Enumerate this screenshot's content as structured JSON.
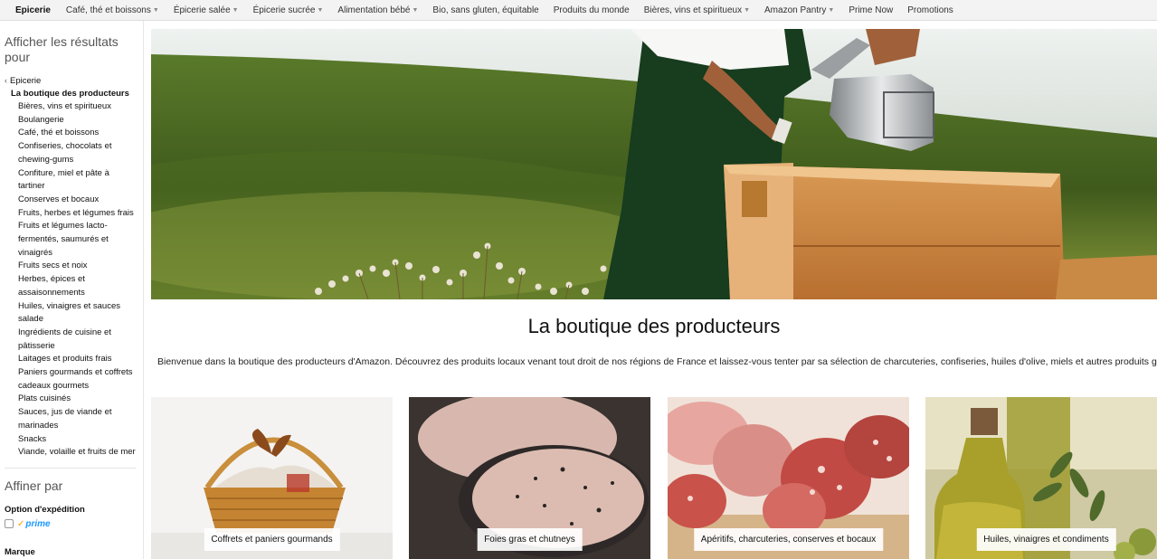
{
  "nav": {
    "brand": "Epicerie",
    "items": [
      {
        "label": "Café, thé et boissons",
        "dropdown": true
      },
      {
        "label": "Épicerie salée",
        "dropdown": true
      },
      {
        "label": "Épicerie sucrée",
        "dropdown": true
      },
      {
        "label": "Alimentation bébé",
        "dropdown": true
      },
      {
        "label": "Bio, sans gluten, équitable",
        "dropdown": false
      },
      {
        "label": "Produits du monde",
        "dropdown": false
      },
      {
        "label": "Bières, vins et spiritueux",
        "dropdown": true
      },
      {
        "label": "Amazon Pantry",
        "dropdown": true
      },
      {
        "label": "Prime Now",
        "dropdown": false
      },
      {
        "label": "Promotions",
        "dropdown": false
      }
    ]
  },
  "sidebar": {
    "heading": "Afficher les résultats pour",
    "back_label": "Epicerie",
    "current": "La boutique des producteurs",
    "categories": [
      "Bières, vins et spiritueux",
      "Boulangerie",
      "Café, thé et boissons",
      "Confiseries, chocolats et chewing-gums",
      "Confiture, miel et pâte à tartiner",
      "Conserves et bocaux",
      "Fruits, herbes et légumes frais",
      "Fruits et légumes lacto-fermentés, saumurés et vinaigrés",
      "Fruits secs et noix",
      "Herbes, épices et assaisonnements",
      "Huiles, vinaigres et sauces salade",
      "Ingrédients de cuisine et pâtisserie",
      "Laitages et produits frais",
      "Paniers gourmands et coffrets cadeaux gourmets",
      "Plats cuisinés",
      "Sauces, jus de viande et marinades",
      "Snacks",
      "Viande, volaille et fruits de mer"
    ],
    "refine_heading": "Affiner par",
    "shipping_heading": "Option d'expédition",
    "prime_label": "prime",
    "brand_heading": "Marque"
  },
  "main": {
    "title": "La boutique des producteurs",
    "intro": "Bienvenue dans la boutique des producteurs d'Amazon. Découvrez des produits locaux venant tout droit de nos régions de France et laissez-vous tenter par sa sélection de charcuteries, confiseries, huiles d'olive, miels et autres produits gourmets",
    "tiles": [
      {
        "label": "Coffrets et paniers gourmands"
      },
      {
        "label": "Foies gras et chutneys"
      },
      {
        "label": "Apéritifs, charcuteries, conserves et bocaux"
      },
      {
        "label": "Huiles, vinaigres et condiments"
      }
    ]
  }
}
